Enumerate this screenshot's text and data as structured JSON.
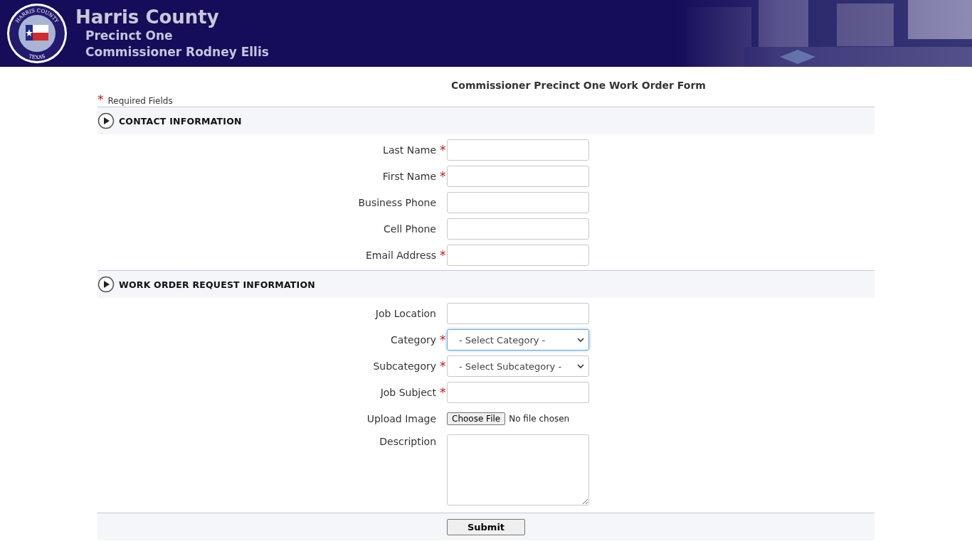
{
  "header": {
    "title": "Harris County",
    "subtitle": "Precinct One",
    "commissioner": "Commissioner Rodney Ellis",
    "seal_top": "HARRIS COUNTY",
    "seal_bottom": "TEXAS"
  },
  "form": {
    "title": "Commissioner Precinct One Work Order Form",
    "required_mark": "*",
    "required_note": "Required Fields",
    "sections": [
      {
        "heading": "CONTACT INFORMATION",
        "fields": [
          {
            "kind": "text",
            "label": "Last Name",
            "required": true
          },
          {
            "kind": "text",
            "label": "First Name",
            "required": true
          },
          {
            "kind": "text",
            "label": "Business Phone",
            "required": false
          },
          {
            "kind": "text",
            "label": "Cell Phone",
            "required": false
          },
          {
            "kind": "text",
            "label": "Email Address",
            "required": true
          }
        ]
      },
      {
        "heading": "WORK ORDER REQUEST INFORMATION",
        "fields": [
          {
            "kind": "text",
            "label": "Job Location",
            "required": false
          },
          {
            "kind": "select",
            "label": "Category",
            "required": true,
            "value": "- Select Category -",
            "focused": true
          },
          {
            "kind": "select",
            "label": "Subcategory",
            "required": true,
            "value": "- Select Subcategory -",
            "focused": false
          },
          {
            "kind": "text",
            "label": "Job Subject",
            "required": true
          },
          {
            "kind": "file",
            "label": "Upload Image",
            "required": false,
            "button": "Choose File",
            "status": "No file chosen"
          },
          {
            "kind": "textarea",
            "label": "Description",
            "required": false
          }
        ]
      }
    ],
    "submit": "Submit"
  }
}
